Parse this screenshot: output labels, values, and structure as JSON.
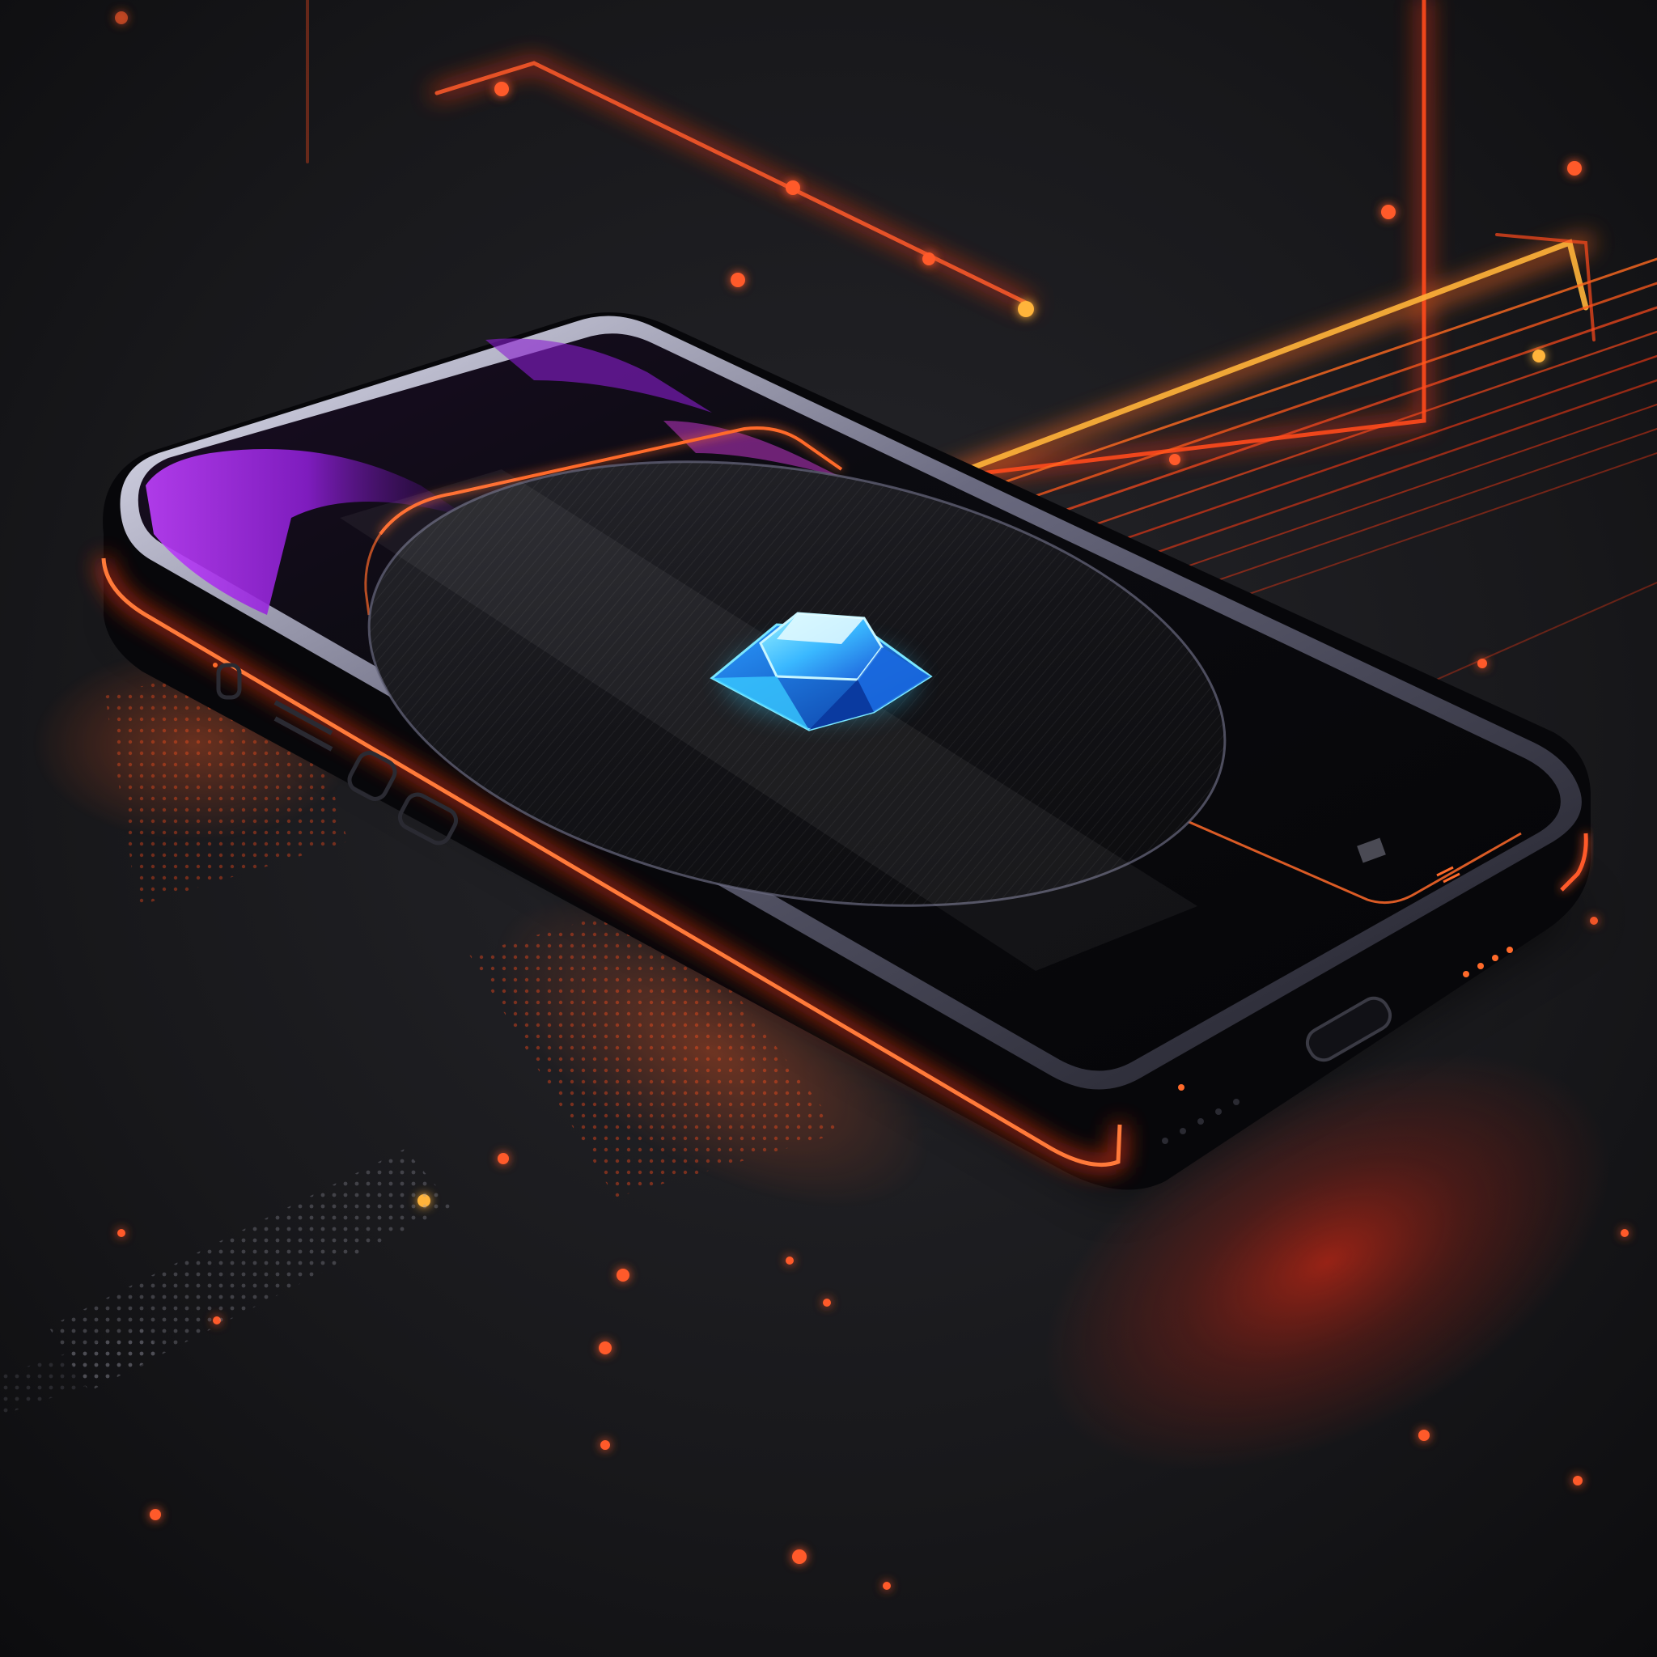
{
  "scene": {
    "subject": "smartphone",
    "screen_icon": "crystal-gem-icon",
    "colors": {
      "background": "#141416",
      "surface": "#1c1c20",
      "neon_orange": "#ff4a1c",
      "neon_amber": "#ff8a2a",
      "neon_yellow": "#ffb43a",
      "screen_purple": "#b43cff",
      "screen_magenta": "#d03ad8",
      "gem_cyan": "#38d0ff",
      "phone_body": "#0a0a0d",
      "phone_rim": "#c8c8d8"
    }
  }
}
